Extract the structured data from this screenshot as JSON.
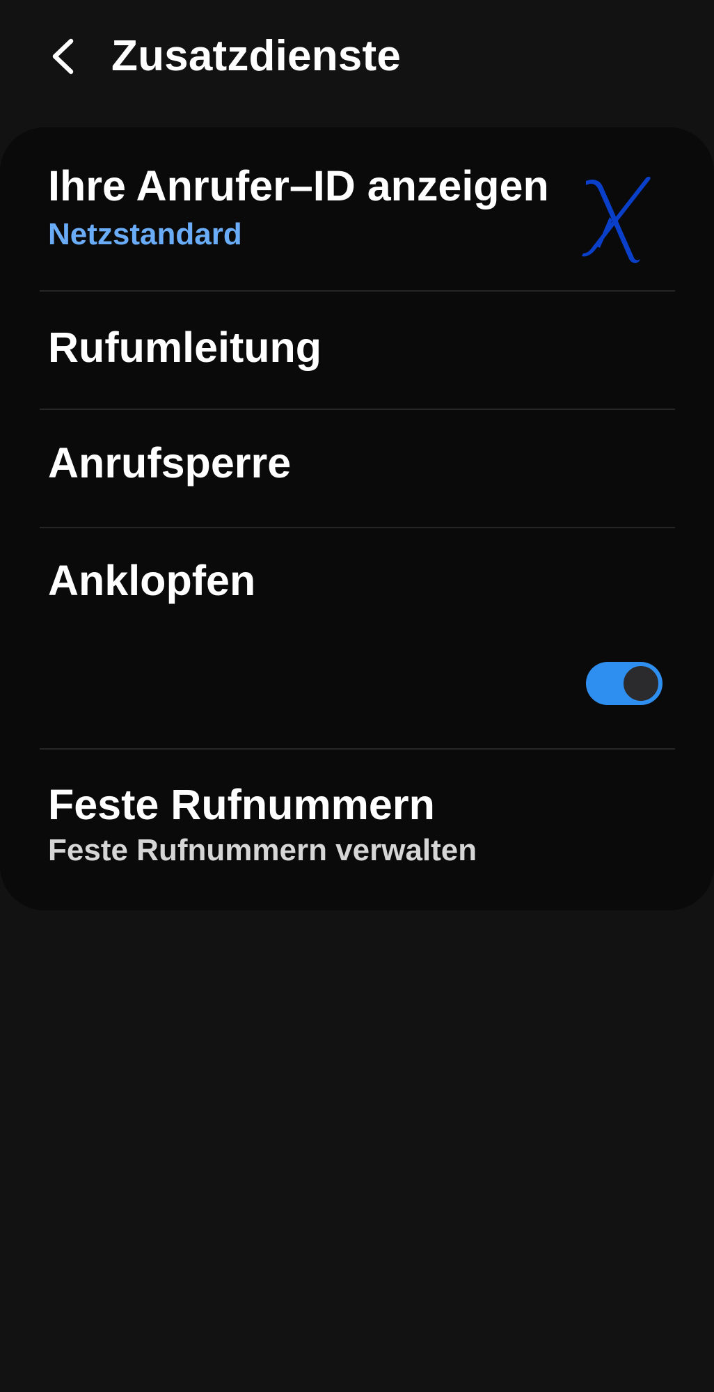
{
  "header": {
    "back_icon": "chevron-left-icon",
    "title": "Zusatzdienste"
  },
  "settings": {
    "caller_id": {
      "title": "Ihre Anrufer–ID anzeigen",
      "value": "Netzstandard",
      "value_color": "#6aacf7"
    },
    "call_forwarding": {
      "title": "Rufumleitung"
    },
    "call_barring": {
      "title": "Anrufsperre"
    },
    "call_waiting": {
      "title": "Anklopfen",
      "enabled": true,
      "toggle_color": "#2f8ff0"
    },
    "fixed_dialing": {
      "title": "Feste Rufnummern",
      "subtitle": "Feste Rufnummern verwalten",
      "subtitle_color": "#d6d6d6"
    }
  },
  "overlay": {
    "mark": "X",
    "mark_icon": "blue-x-mark-icon",
    "color": "#0a3fc9"
  },
  "colors": {
    "background": "#121212",
    "card": "#0a0a0a",
    "divider": "#262626"
  }
}
